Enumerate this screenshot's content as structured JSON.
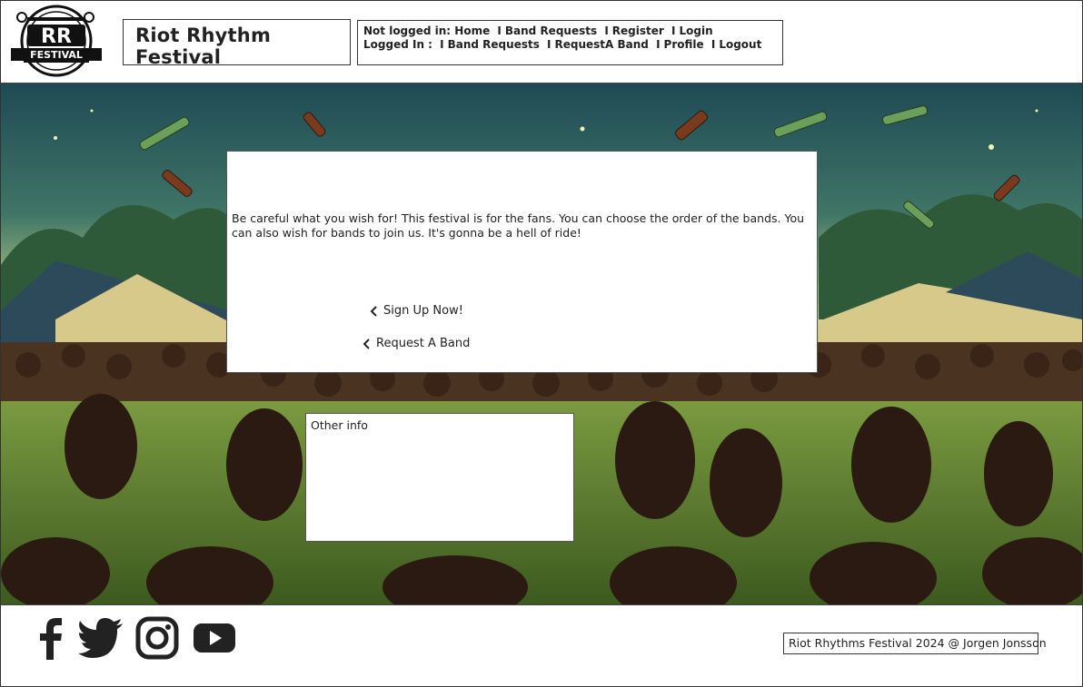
{
  "header": {
    "logo_text_top": "RR",
    "logo_text_bottom": "FESTIVAL",
    "title": "Riot Rhythm Festival"
  },
  "nav": {
    "logged_out_prefix": "Not logged in:",
    "logged_out_links": [
      "Home",
      "Band Requests",
      "Register",
      "Login"
    ],
    "logged_in_prefix": "Logged In :",
    "logged_in_links": [
      "Band Requests",
      "RequestA Band",
      "Profile",
      "Logout"
    ],
    "separator": "I"
  },
  "main": {
    "intro": "Be careful what you wish for! This festival is for the fans. You can choose the order of the bands. You can also wish for bands to join us. It's gonna be a hell of ride!",
    "signup_label": "Sign Up Now!",
    "request_label": "Request A Band"
  },
  "info": {
    "title": "Other info"
  },
  "footer": {
    "social_icons": [
      "facebook-icon",
      "twitter-icon",
      "instagram-icon",
      "youtube-icon"
    ],
    "copyright": "Riot Rhythms Festival 2024 @ Jorgen Jonsson"
  },
  "colors": {
    "text": "#222222",
    "sky_top": "#1f4a55",
    "sky_horizon": "#c9d88a",
    "grass": "#6f8f3a",
    "crowd": "#3a2418"
  }
}
